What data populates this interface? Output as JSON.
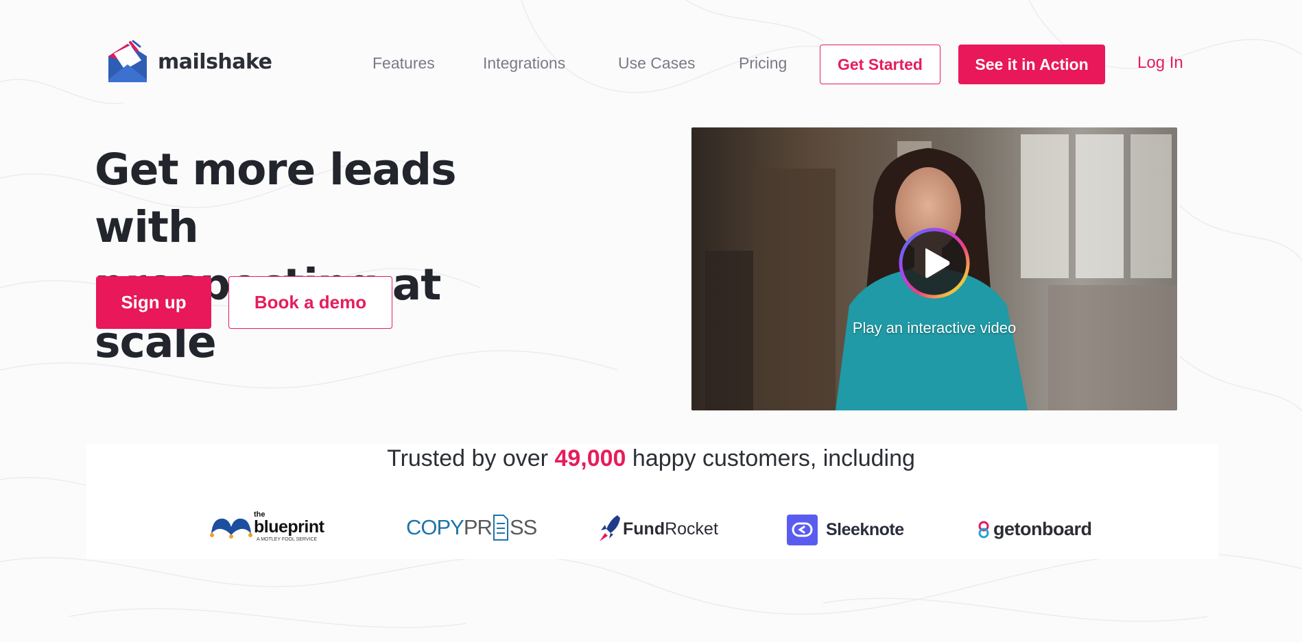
{
  "brand": {
    "name": "mailshake"
  },
  "nav": {
    "items": [
      {
        "label": "Features"
      },
      {
        "label": "Integrations"
      },
      {
        "label": "Use Cases"
      },
      {
        "label": "Pricing"
      }
    ],
    "get_started": "Get Started",
    "see_in_action": "See it in Action",
    "login": "Log In"
  },
  "hero": {
    "title_line1": "Get more leads with",
    "title_line2": "prospecting at scale",
    "signup": "Sign up",
    "book_demo": "Book a demo"
  },
  "video": {
    "caption": "Play an interactive video"
  },
  "trusted": {
    "prefix": "Trusted by over",
    "count": "49,000",
    "suffix": "happy customers, including"
  },
  "customers": [
    {
      "name": "the blueprint",
      "line1": "the",
      "line2": "blueprint",
      "tagline": "A MOTLEY FOOL SERVICE",
      "icon": "blueprint-logo-icon"
    },
    {
      "name": "COPYPRESS",
      "part1": "COPY",
      "part2": "PR",
      "part3": "SS",
      "icon": "copypress-logo-icon"
    },
    {
      "name": "FundRocket",
      "part1": "Fund",
      "part2": "Rocket",
      "icon": "rocket-icon"
    },
    {
      "name": "Sleeknote",
      "icon": "sleeknote-logo-icon"
    },
    {
      "name": "getonboard",
      "icon": "getonboard-logo-icon"
    }
  ],
  "colors": {
    "accent": "#e61c5b",
    "text_dark": "#22252c",
    "nav_text": "#777b84",
    "sleeknote": "#5a5cf0",
    "copypress": "#1e73a8",
    "blueprint_blue": "#1d4fa0"
  }
}
